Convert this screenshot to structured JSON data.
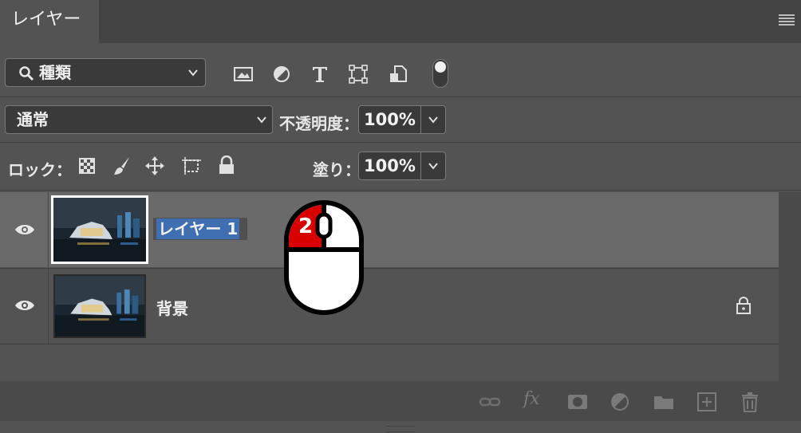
{
  "panel": {
    "tab_label": "レイヤー"
  },
  "filter": {
    "search_icon": "search-icon",
    "kind_label": "種類",
    "icons": [
      "image-filter-icon",
      "adjustment-filter-icon",
      "type-filter-icon",
      "shape-filter-icon",
      "smart-object-filter-icon",
      "filter-toggle"
    ]
  },
  "blend": {
    "mode": "通常",
    "opacity_label": "不透明度：",
    "opacity_value": "100%"
  },
  "lock": {
    "label": "ロック：",
    "fill_label": "塗り：",
    "fill_value": "100%",
    "icons": [
      "lock-transparent-icon",
      "lock-image-icon",
      "lock-position-icon",
      "lock-artboard-icon",
      "lock-all-icon"
    ]
  },
  "layers": [
    {
      "name": "レイヤー 1",
      "selected": true,
      "editing": true,
      "visible": true,
      "locked": false
    },
    {
      "name": "背景",
      "selected": false,
      "editing": false,
      "visible": true,
      "locked": true
    }
  ],
  "overlay": {
    "mouse_click_count": "2"
  },
  "footer": {
    "icons": [
      "link-icon",
      "fx-icon",
      "mask-icon",
      "adjustment-icon",
      "folder-icon",
      "new-layer-icon",
      "trash-icon"
    ],
    "fx_label": "fx"
  },
  "colors": {
    "selected_row": "#6a6a6a",
    "rename_highlight": "#3f6fb0",
    "mouse_red": "#d90000"
  }
}
